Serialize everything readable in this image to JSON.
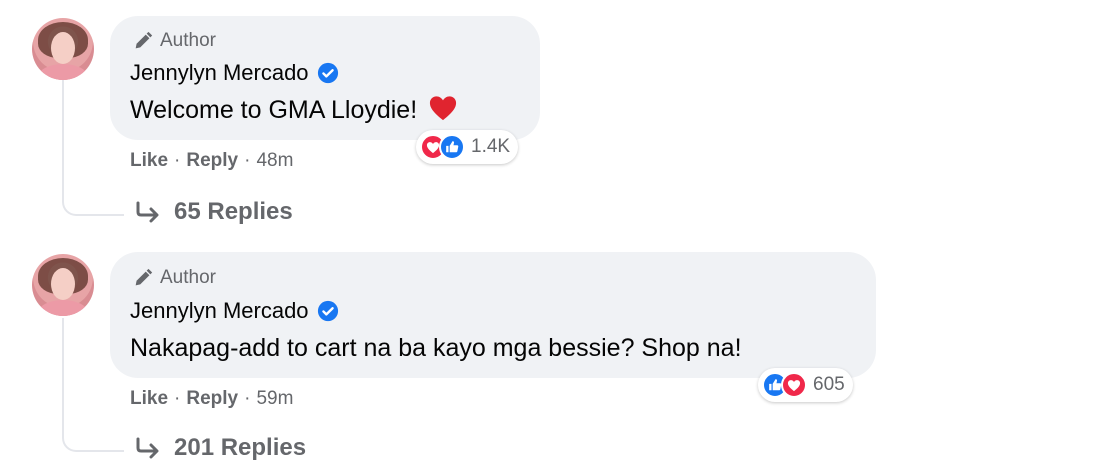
{
  "comments": [
    {
      "badge": "Author",
      "author": "Jennylyn Mercado",
      "text": "Welcome to GMA Lloydie!",
      "reaction_count": "1.4K",
      "actions": {
        "like": "Like",
        "reply": "Reply",
        "time": "48m"
      },
      "replies_label": "65 Replies"
    },
    {
      "badge": "Author",
      "author": "Jennylyn Mercado",
      "text": "Nakapag-add to cart na ba kayo mga bessie? Shop na!",
      "reaction_count": "605",
      "actions": {
        "like": "Like",
        "reply": "Reply",
        "time": "59m"
      },
      "replies_label": "201 Replies"
    }
  ],
  "separator": "·",
  "colors": {
    "like_blue": "#1877f2",
    "love_red": "#f0284a",
    "bubble_bg": "#f0f2f5",
    "muted_text": "#65676b"
  }
}
